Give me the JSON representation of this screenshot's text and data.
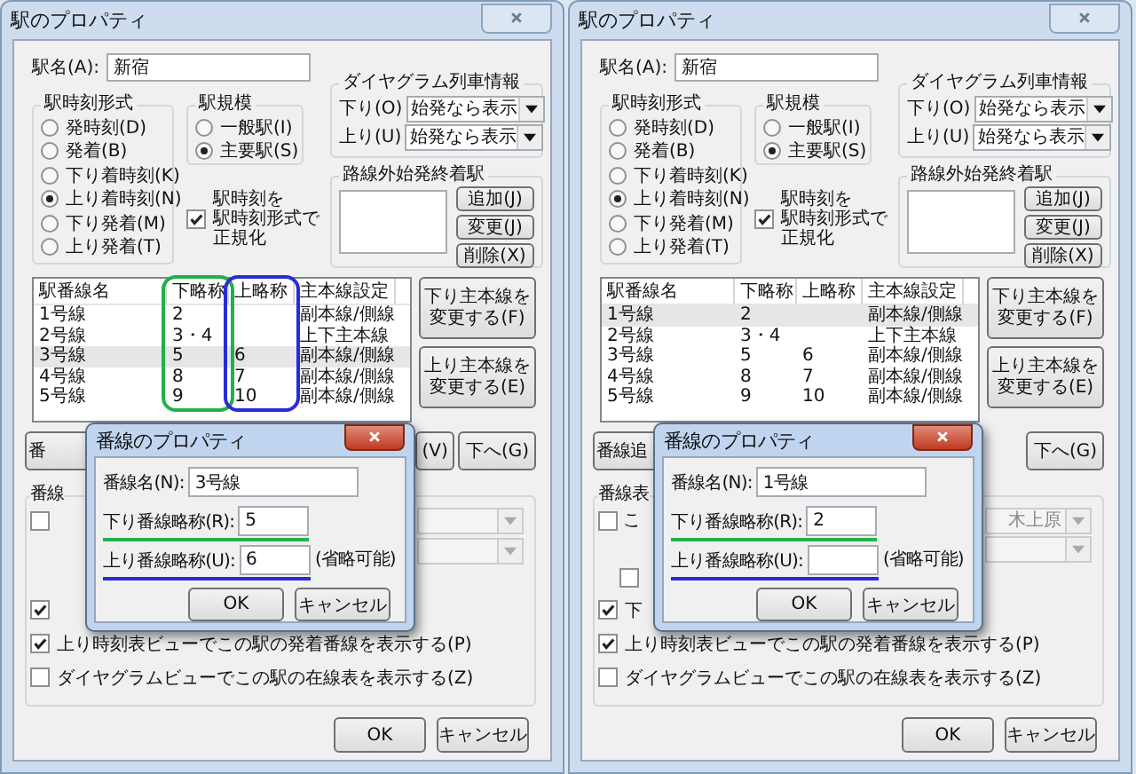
{
  "dialogs": [
    {
      "title": "駅のプロパティ",
      "station_name": {
        "label": "駅名(A):",
        "value": "新宿"
      },
      "time_format": {
        "title": "駅時刻形式",
        "options": [
          {
            "label": "発時刻(D)",
            "selected": false
          },
          {
            "label": "発着(B)",
            "selected": false
          },
          {
            "label": "下り着時刻(K)",
            "selected": false
          },
          {
            "label": "上り着時刻(N)",
            "selected": true
          },
          {
            "label": "下り発着(M)",
            "selected": false
          },
          {
            "label": "上り発着(T)",
            "selected": false
          }
        ]
      },
      "scale": {
        "title": "駅規模",
        "options": [
          {
            "label": "一般駅(I)",
            "selected": false
          },
          {
            "label": "主要駅(S)",
            "selected": true
          }
        ]
      },
      "normalize": {
        "lines": [
          "駅時刻を",
          "駅時刻形式で",
          "正規化"
        ],
        "checked": true
      },
      "diagram_info": {
        "title": "ダイヤグラム列車情報",
        "rows": [
          {
            "label": "下り(O)",
            "value": "始発なら表示"
          },
          {
            "label": "上り(U)",
            "value": "始発なら表示"
          }
        ]
      },
      "outside_stations": {
        "title": "路線外始発終着駅",
        "buttons": [
          "追加(J)",
          "変更(J)",
          "削除(X)"
        ]
      },
      "tracks": {
        "columns": [
          {
            "label": "駅番線名"
          },
          {
            "label": "下略称",
            "color": "#22b04a"
          },
          {
            "label": "上略称",
            "color": "#2a2ad8"
          },
          {
            "label": "主本線設定"
          }
        ],
        "rows": [
          {
            "name": "1号線",
            "down": "2",
            "main": "副本線/側線",
            "selected": false
          },
          {
            "name": "2号線",
            "down": "3・4",
            "main": "上下主本線",
            "selected": false
          },
          {
            "name": "3号線",
            "down": "5",
            "up": "6",
            "main": "副本線/側線",
            "selected": true
          },
          {
            "name": "4号線",
            "down": "8",
            "up": "7",
            "main": "副本線/側線",
            "selected": false
          },
          {
            "name": "5号線",
            "down": "9",
            "up": "10",
            "main": "副本線/側線",
            "selected": false
          }
        ]
      },
      "main_line_buttons": [
        {
          "lines": [
            "下り主本線を",
            "変更する(F)"
          ]
        },
        {
          "lines": [
            "上り主本線を",
            "変更する(E)"
          ]
        }
      ],
      "order_buttons": [
        "番",
        "(V)",
        "下へ(G)"
      ],
      "display_group": {
        "title": "番線",
        "items": [
          {
            "kind": "check_combo",
            "checked": false,
            "disabled": true
          },
          {
            "kind": "combo",
            "disabled": true
          },
          {
            "kind": "check",
            "checked": true
          },
          {
            "kind": "check",
            "label": "上り時刻表ビューでこの駅の発着番線を表示する(P)",
            "checked": true
          },
          {
            "kind": "check",
            "label": "ダイヤグラムビューでこの駅の在線表を表示する(Z)",
            "checked": false
          }
        ]
      },
      "buttons": [
        "OK",
        "キャンセル"
      ],
      "subdialog": {
        "title": "番線のプロパティ",
        "fields": [
          {
            "label": "番線名(N):",
            "value": "3号線"
          },
          {
            "label": "下り番線略称(R):",
            "value": "5",
            "color": "#22b04a"
          },
          {
            "label": "上り番線略称(U):",
            "value": "6",
            "note": "(省略可能)",
            "color": "#2a2ad8"
          }
        ],
        "buttons": [
          "OK",
          "キャンセル"
        ]
      }
    },
    {
      "title": "駅のプロパティ",
      "station_name": {
        "label": "駅名(A):",
        "value": "新宿"
      },
      "time_format": {
        "title": "駅時刻形式",
        "options": [
          {
            "label": "発時刻(D)",
            "selected": false
          },
          {
            "label": "発着(B)",
            "selected": false
          },
          {
            "label": "下り着時刻(K)",
            "selected": false
          },
          {
            "label": "上り着時刻(N)",
            "selected": true
          },
          {
            "label": "下り発着(M)",
            "selected": false
          },
          {
            "label": "上り発着(T)",
            "selected": false
          }
        ]
      },
      "scale": {
        "title": "駅規模",
        "options": [
          {
            "label": "一般駅(I)",
            "selected": false
          },
          {
            "label": "主要駅(S)",
            "selected": true
          }
        ]
      },
      "normalize": {
        "lines": [
          "駅時刻を",
          "駅時刻形式で",
          "正規化"
        ],
        "checked": true
      },
      "diagram_info": {
        "title": "ダイヤグラム列車情報",
        "rows": [
          {
            "label": "下り(O)",
            "value": "始発なら表示"
          },
          {
            "label": "上り(U)",
            "value": "始発なら表示"
          }
        ]
      },
      "outside_stations": {
        "title": "路線外始発終着駅",
        "buttons": [
          "追加(J)",
          "変更(J)",
          "削除(X)"
        ]
      },
      "tracks": {
        "columns": [
          {
            "label": "駅番線名"
          },
          {
            "label": "下略称"
          },
          {
            "label": "上略称"
          },
          {
            "label": "主本線設定"
          }
        ],
        "rows": [
          {
            "name": "1号線",
            "down": "2",
            "main": "副本線/側線",
            "selected": true
          },
          {
            "name": "2号線",
            "down": "3・4",
            "main": "上下主本線",
            "selected": false
          },
          {
            "name": "3号線",
            "down": "5",
            "up": "6",
            "main": "副本線/側線",
            "selected": false
          },
          {
            "name": "4号線",
            "down": "8",
            "up": "7",
            "main": "副本線/側線",
            "selected": false
          },
          {
            "name": "5号線",
            "down": "9",
            "up": "10",
            "main": "副本線/側線",
            "selected": false
          }
        ]
      },
      "main_line_buttons": [
        {
          "lines": [
            "下り主本線を",
            "変更する(F)"
          ]
        },
        {
          "lines": [
            "上り主本線を",
            "変更する(E)"
          ]
        }
      ],
      "order_buttons": [
        "番線追",
        "下へ(G)"
      ],
      "display_group": {
        "title": "番線表",
        "items": [
          {
            "kind": "check_combo",
            "checked": false,
            "label": "こ",
            "value": "木上原",
            "disabled": true
          },
          {
            "kind": "combo",
            "disabled": true
          },
          {
            "kind": "sub_check",
            "checked": false
          },
          {
            "kind": "check",
            "label": "下",
            "checked": true
          },
          {
            "kind": "check",
            "label": "上り時刻表ビューでこの駅の発着番線を表示する(P)",
            "checked": true
          },
          {
            "kind": "check",
            "label": "ダイヤグラムビューでこの駅の在線表を表示する(Z)",
            "checked": false
          }
        ]
      },
      "buttons": [
        "OK",
        "キャンセル"
      ],
      "subdialog": {
        "title": "番線のプロパティ",
        "fields": [
          {
            "label": "番線名(N):",
            "value": "1号線"
          },
          {
            "label": "下り番線略称(R):",
            "value": "2",
            "color": "#22b04a"
          },
          {
            "label": "上り番線略称(U):",
            "note": "(省略可能)",
            "color": "#2a2ad8"
          }
        ],
        "buttons": [
          "OK",
          "キャンセル"
        ]
      }
    }
  ]
}
